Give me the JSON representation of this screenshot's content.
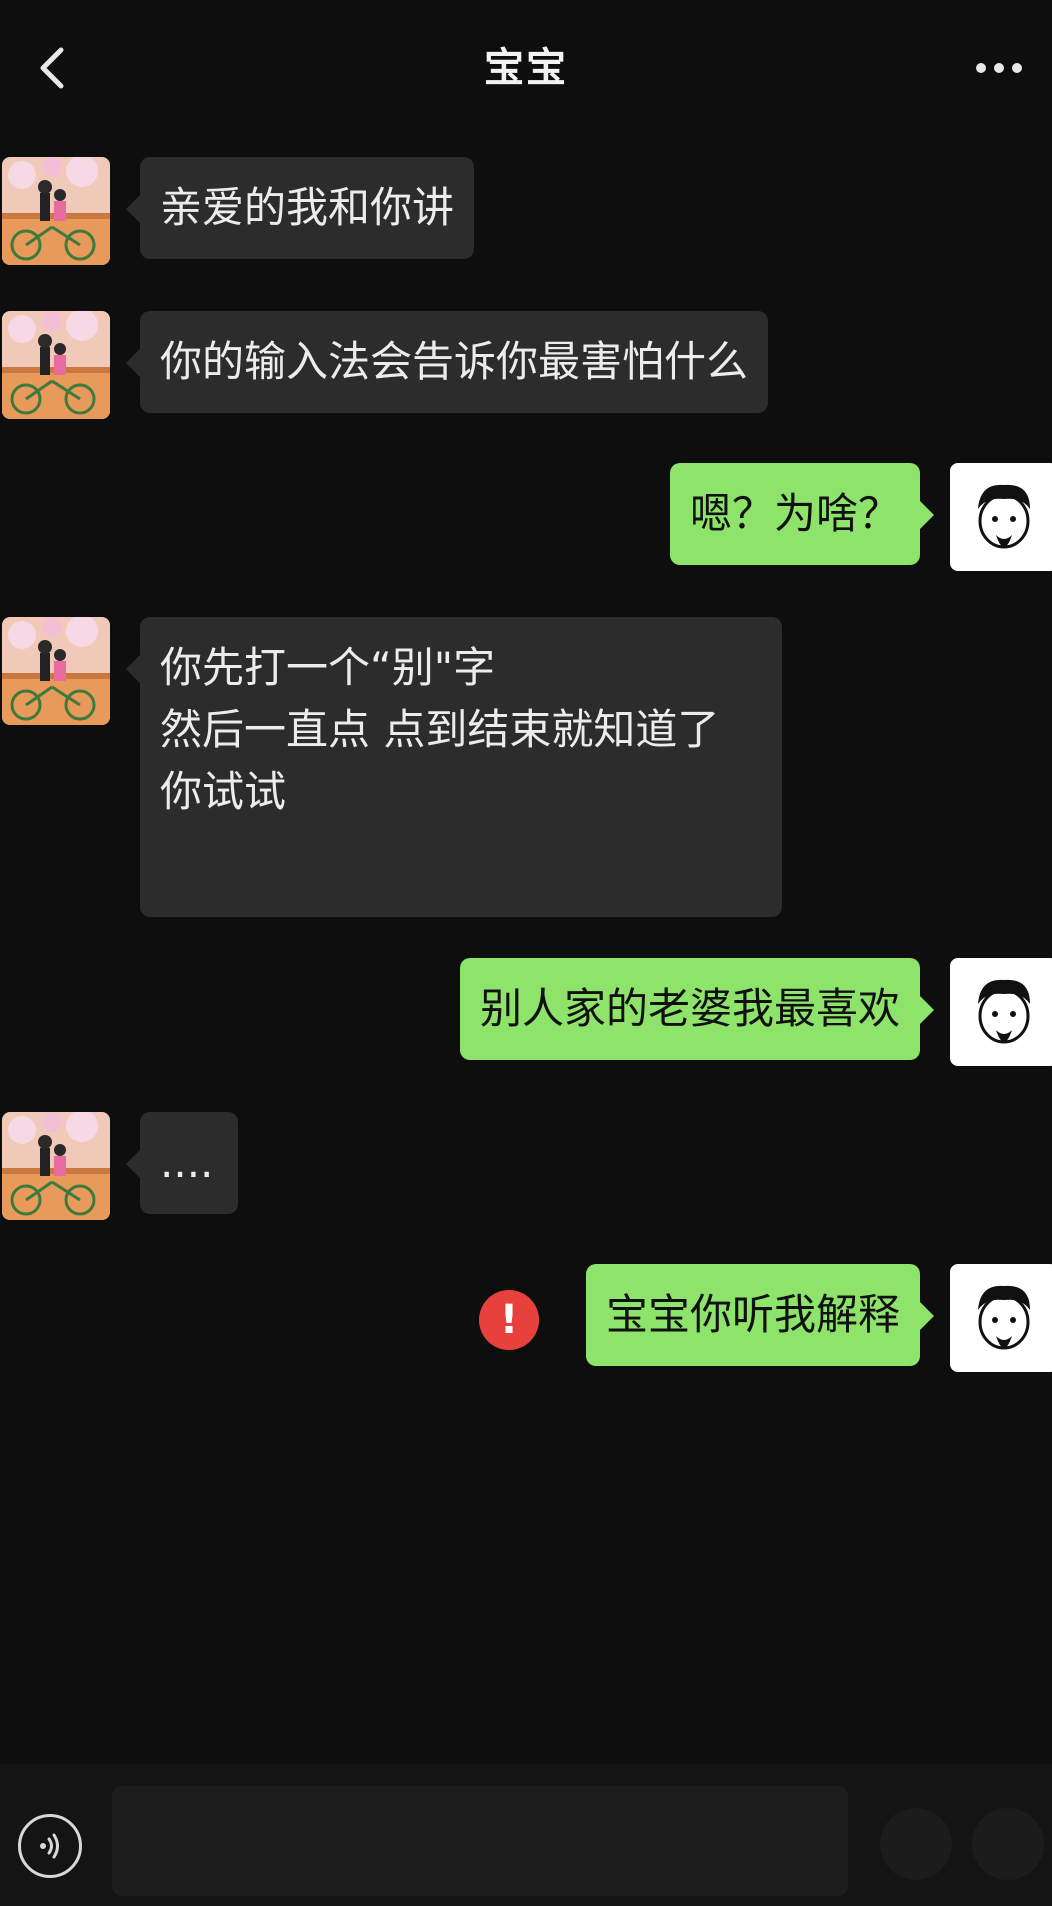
{
  "header": {
    "title": "宝宝"
  },
  "messages": [
    {
      "side": "in",
      "text": "亲爱的我和你讲"
    },
    {
      "side": "in",
      "text": "你的输入法会告诉你最害怕什么"
    },
    {
      "side": "out",
      "text": "嗯？为啥？"
    },
    {
      "side": "in",
      "text": "你先打一个“别\"字\n然后一直点 点到结束就知道了\n你试试"
    },
    {
      "side": "out",
      "text": "别人家的老婆我最喜欢"
    },
    {
      "side": "in",
      "text": "...."
    },
    {
      "side": "out",
      "text": "宝宝你听我解释",
      "status": "failed"
    }
  ],
  "status": {
    "failed_mark": "!"
  },
  "icons": {
    "back": "chevron-left-icon",
    "more": "more-dots-icon",
    "voice": "voice-input-icon",
    "failed": "send-failed-icon"
  },
  "colors": {
    "background": "#0e0e0e",
    "incoming_bubble": "#2c2c2c",
    "outgoing_bubble": "#8ee36b",
    "error": "#e8413d"
  }
}
